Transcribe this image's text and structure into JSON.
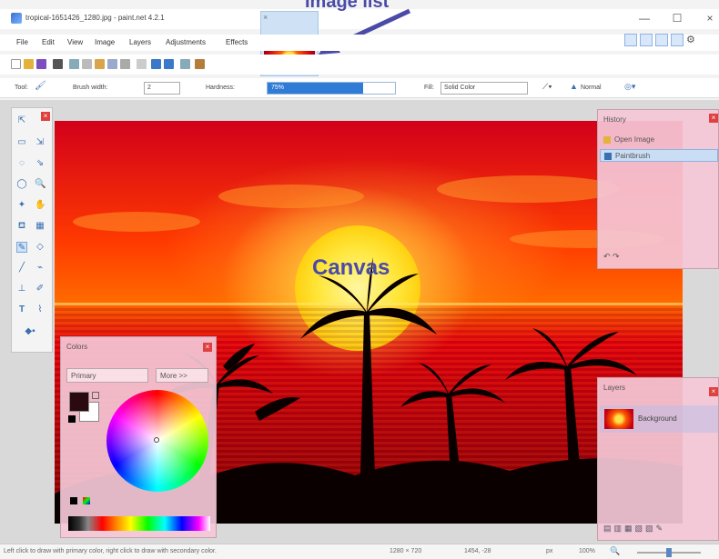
{
  "annotations": {
    "image_list_label": "Image list",
    "canvas_label": "Canvas"
  },
  "window": {
    "title": "tropical-1651426_1280.jpg - paint.net 4.2.1",
    "minimize": "—",
    "maximize": "☐",
    "close": "×"
  },
  "image_list": {
    "close": "×"
  },
  "menu": {
    "file": "File",
    "edit": "Edit",
    "view": "View",
    "image": "Image",
    "layers": "Layers",
    "adjustments": "Adjustments",
    "effects": "Effects"
  },
  "toolbar": {
    "tool_label": "Tool:",
    "brush_width_label": "Brush width:",
    "brush_width_value": "2",
    "hardness_label": "Hardness:",
    "hardness_value": "75%",
    "hardness_fraction": 0.75,
    "fill_label": "Fill:",
    "fill_value": "Solid Color",
    "blend_mode": "Normal"
  },
  "colors_panel": {
    "title": "Colors",
    "mode": "Primary",
    "more_label": "More >>",
    "primary_color": "#2a0a0f",
    "secondary_color": "#ffffff"
  },
  "history_panel": {
    "title": "History",
    "items": [
      {
        "label": "Open Image",
        "selected": false
      },
      {
        "label": "Paintbrush",
        "selected": true
      }
    ]
  },
  "layers_panel": {
    "title": "Layers",
    "layer_name": "Background"
  },
  "status": {
    "hint": "Left click to draw with primary color, right click to draw with secondary color.",
    "image_size": "1280 × 720",
    "cursor_pos": "1454, -28",
    "units": "px",
    "zoom": "100%"
  },
  "colors": {
    "accent": "#2f7bd6",
    "annotation": "#4a4aa8",
    "panel_pink": "#f5c8d7"
  }
}
